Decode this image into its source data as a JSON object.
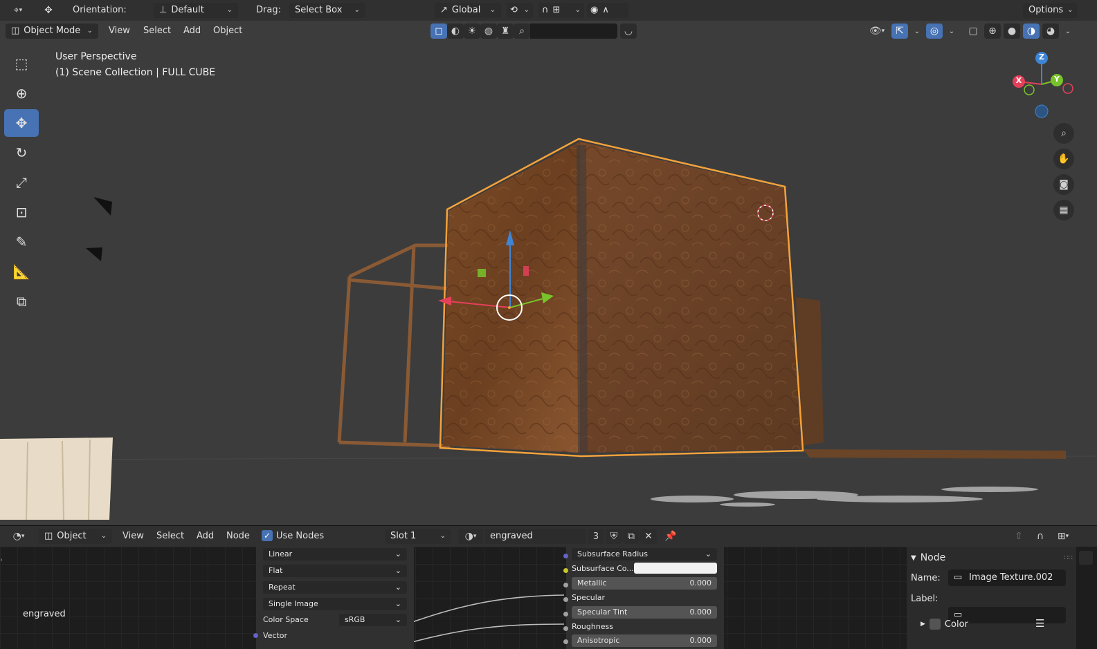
{
  "top_bar": {
    "orientation_label": "Orientation:",
    "orientation_value": "Default",
    "drag_label": "Drag:",
    "drag_value": "Select Box",
    "transform_space": "Global",
    "options_label": "Options"
  },
  "mode_bar": {
    "mode": "Object Mode",
    "menus": [
      "View",
      "Select",
      "Add",
      "Object"
    ]
  },
  "viewport": {
    "view_name": "User Perspective",
    "collection_info": "(1) Scene Collection | FULL CUBE",
    "gizmo_axes": {
      "x": "X",
      "y": "Y",
      "z": "Z"
    }
  },
  "node_header": {
    "editor_type": "Object",
    "menus": [
      "View",
      "Select",
      "Add",
      "Node"
    ],
    "use_nodes_label": "Use Nodes",
    "use_nodes_checked": true,
    "slot": "Slot 1",
    "material_name": "engraved",
    "user_count": "3"
  },
  "image_texture_node": {
    "interpolation": "Linear",
    "projection": "Flat",
    "extension": "Repeat",
    "source": "Single Image",
    "color_space_label": "Color Space",
    "color_space_value": "sRGB",
    "vector_label": "Vector"
  },
  "frame_label": "engraved",
  "bsdf_node": {
    "subsurface_radius": "Subsurface Radius",
    "subsurface_color_label": "Subsurface Co...",
    "metallic_label": "Metallic",
    "metallic_value": "0.000",
    "specular_label": "Specular",
    "specular_tint_label": "Specular Tint",
    "specular_tint_value": "0.000",
    "roughness_label": "Roughness",
    "anisotropic_label": "Anisotropic",
    "anisotropic_value": "0.000"
  },
  "side_panel": {
    "section": "Node",
    "name_label": "Name:",
    "name_value": "Image Texture.002",
    "label_label": "Label:",
    "label_value": "",
    "color_label": "Color"
  },
  "colors": {
    "selection_outline": "#f5a23a",
    "active_tool": "#4772b3",
    "axis_x": "#e5405a",
    "axis_y": "#78c32a",
    "axis_z": "#3e85d6"
  }
}
